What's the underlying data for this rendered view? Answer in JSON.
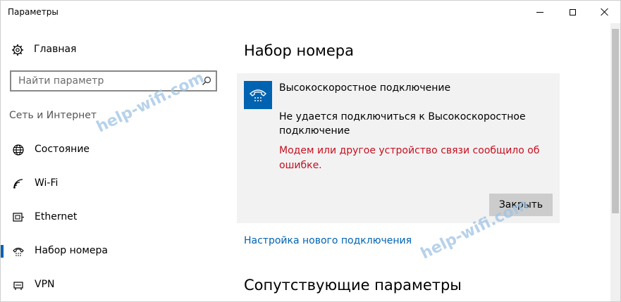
{
  "window": {
    "title": "Параметры"
  },
  "sidebar": {
    "home_label": "Главная",
    "search_placeholder": "Найти параметр",
    "section_title": "Сеть и Интернет",
    "items": [
      {
        "label": "Состояние",
        "icon": "globe-icon",
        "active": false
      },
      {
        "label": "Wi-Fi",
        "icon": "wifi-icon",
        "active": false
      },
      {
        "label": "Ethernet",
        "icon": "ethernet-icon",
        "active": false
      },
      {
        "label": "Набор номера",
        "icon": "dialup-phone-icon",
        "active": true
      },
      {
        "label": "VPN",
        "icon": "vpn-icon",
        "active": false
      }
    ]
  },
  "main": {
    "page_title": "Набор номера",
    "connection": {
      "name": "Высокоскоростное подключение",
      "message": "Не удается подключиться к Высокоскоростное подключение",
      "error": "Модем или другое устройство связи сообщило об ошибке.",
      "close_label": "Закрыть"
    },
    "new_connection_link": "Настройка нового подключения",
    "related_title": "Сопутствующие параметры"
  },
  "watermark": "help-wifi.com",
  "colors": {
    "accent": "#0063b1",
    "error": "#c50f1f",
    "card_bg": "#f2f2f2"
  }
}
